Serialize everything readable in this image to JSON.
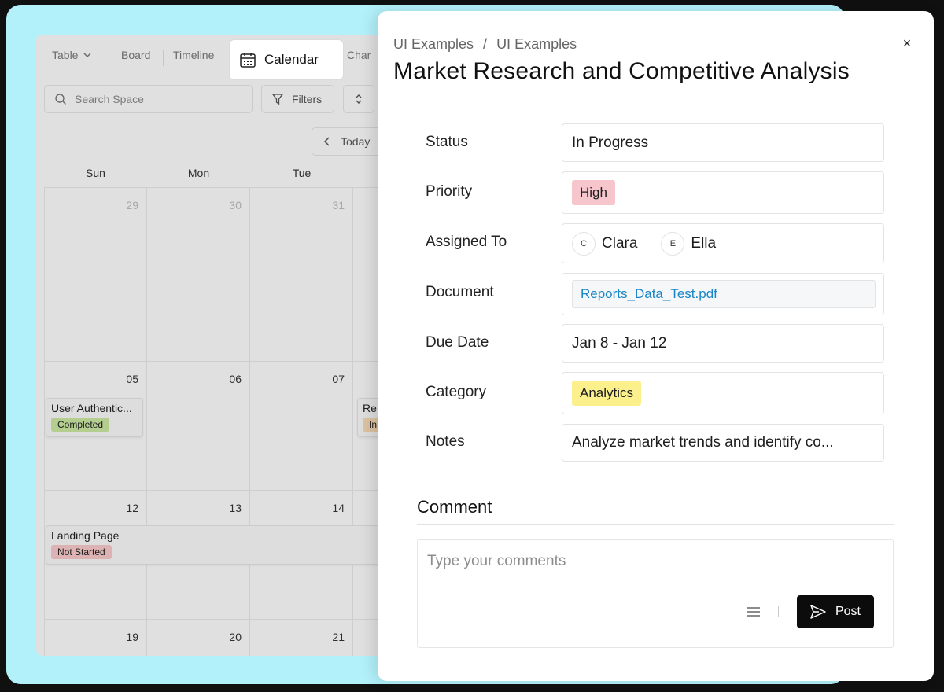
{
  "views": {
    "table_label": "Table",
    "board_label": "Board",
    "timeline_label": "Timeline",
    "calendar_label": "Calendar",
    "chart_label": "Char"
  },
  "toolbar": {
    "search_placeholder": "Search Space",
    "filters_label": "Filters",
    "today_label": "Today"
  },
  "calendar": {
    "weekdays": [
      "Sun",
      "Mon",
      "Tue"
    ],
    "weeks": [
      [
        "29",
        "30",
        "31"
      ],
      [
        "05",
        "06",
        "07"
      ],
      [
        "12",
        "13",
        "14"
      ],
      [
        "19",
        "20",
        "21"
      ]
    ],
    "events": [
      {
        "title": "User Authentic...",
        "status": "Completed",
        "status_color": "#c8e6a0"
      },
      {
        "title": "Re",
        "status": "In",
        "status_color": "#f5d9b3"
      },
      {
        "title": "Landing Page",
        "status": "Not Started",
        "status_color": "#f6c7c7"
      }
    ]
  },
  "panel": {
    "breadcrumb": [
      "UI Examples",
      "/",
      "UI Examples"
    ],
    "title": "Market Research and Competitive Analysis",
    "close_icon": "×",
    "fields": {
      "status_label": "Status",
      "status_value": "In Progress",
      "priority_label": "Priority",
      "priority_value": "High",
      "priority_color": "#f7c6cd",
      "assigned_label": "Assigned To",
      "assignees": [
        {
          "initial": "C",
          "name": "Clara"
        },
        {
          "initial": "E",
          "name": "Ella"
        }
      ],
      "document_label": "Document",
      "document_value": "Reports_Data_Test.pdf",
      "due_label": "Due Date",
      "due_value": "Jan 8 - Jan 12",
      "category_label": "Category",
      "category_value": "Analytics",
      "category_color": "#fbf08c",
      "notes_label": "Notes",
      "notes_value": "Analyze market trends and identify co..."
    },
    "comment": {
      "title": "Comment",
      "placeholder": "Type your comments",
      "post_label": "Post"
    }
  }
}
